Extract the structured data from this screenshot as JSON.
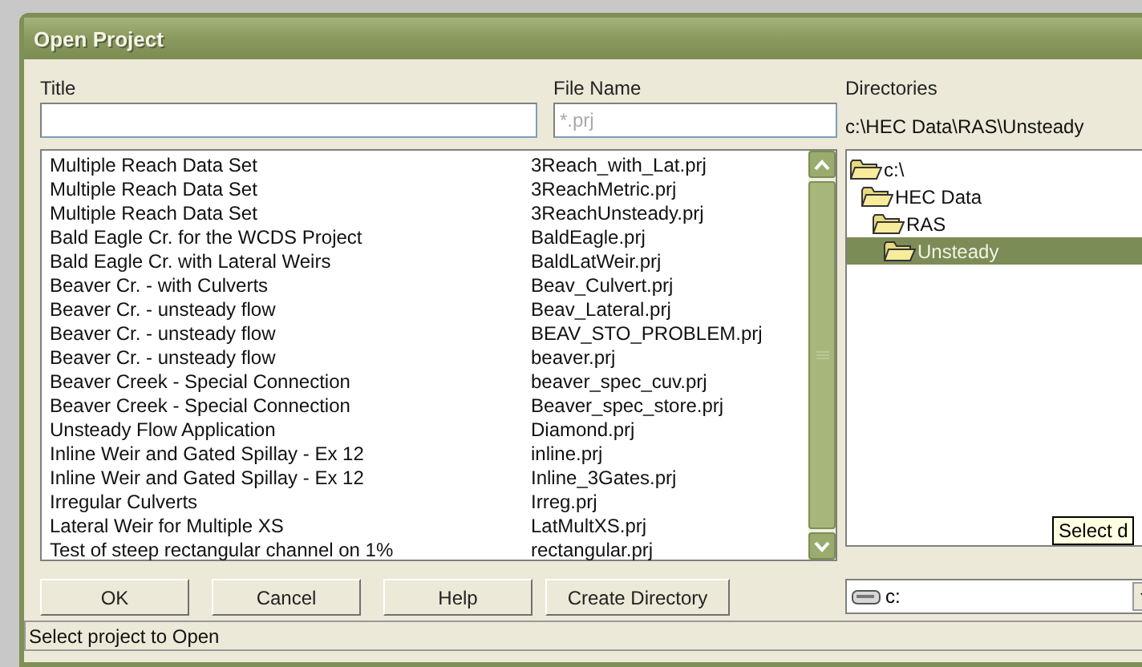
{
  "window": {
    "title": "Open Project"
  },
  "title_field": {
    "label": "Title"
  },
  "file_name_field": {
    "label": "File Name",
    "placeholder": "*.prj"
  },
  "directories": {
    "label": "Directories",
    "path": "c:\\HEC Data\\RAS\\Unsteady",
    "tree": [
      {
        "label": "c:\\",
        "selected": false,
        "children": [
          {
            "label": "HEC Data",
            "selected": false,
            "children": [
              {
                "label": "RAS",
                "selected": false,
                "children": [
                  {
                    "label": "Unsteady",
                    "selected": true
                  }
                ]
              }
            ]
          }
        ]
      }
    ],
    "tooltip": "Select d"
  },
  "projects": [
    {
      "title": "Multiple Reach Data Set",
      "file": "3Reach_with_Lat.prj"
    },
    {
      "title": "Multiple Reach Data Set",
      "file": "3ReachMetric.prj"
    },
    {
      "title": "Multiple Reach Data Set",
      "file": "3ReachUnsteady.prj"
    },
    {
      "title": "Bald Eagle Cr. for the WCDS Project",
      "file": "BaldEagle.prj"
    },
    {
      "title": "Bald Eagle Cr. with Lateral Weirs",
      "file": "BaldLatWeir.prj"
    },
    {
      "title": "Beaver Cr. - with Culverts",
      "file": "Beav_Culvert.prj"
    },
    {
      "title": "Beaver Cr. - unsteady flow",
      "file": "Beav_Lateral.prj"
    },
    {
      "title": "Beaver Cr. - unsteady flow",
      "file": "BEAV_STO_PROBLEM.prj"
    },
    {
      "title": "Beaver Cr. - unsteady flow",
      "file": "beaver.prj"
    },
    {
      "title": "Beaver Creek - Special Connection",
      "file": "beaver_spec_cuv.prj"
    },
    {
      "title": "Beaver Creek - Special Connection",
      "file": "Beaver_spec_store.prj"
    },
    {
      "title": "Unsteady Flow Application",
      "file": "Diamond.prj"
    },
    {
      "title": "Inline Weir and Gated Spillay - Ex 12",
      "file": "inline.prj"
    },
    {
      "title": "Inline Weir and Gated Spillay - Ex 12",
      "file": "Inline_3Gates.prj"
    },
    {
      "title": "Irregular Culverts",
      "file": "Irreg.prj"
    },
    {
      "title": "Lateral Weir for Multiple XS",
      "file": "LatMultXS.prj"
    },
    {
      "title": "Test of steep rectangular channel on 1%",
      "file": "rectangular.prj"
    }
  ],
  "buttons": [
    "OK",
    "Cancel",
    "Help",
    "Create Directory"
  ],
  "drive": {
    "value": "c:"
  },
  "status_bar": "Select project to Open"
}
